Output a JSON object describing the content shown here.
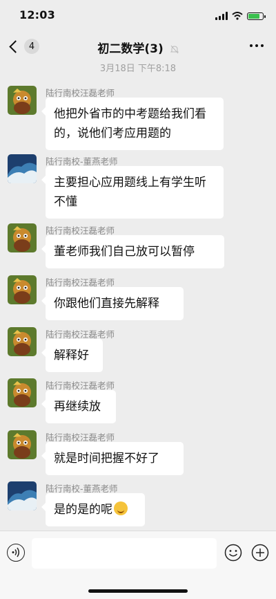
{
  "status_bar": {
    "time": "12:03"
  },
  "nav": {
    "unread_count": "4",
    "title": "初二数学(3)"
  },
  "timestamp": "3月18日 下午8:18",
  "messages": [
    {
      "sender": "陆行南校汪磊老师",
      "text": "他把外省市的中考题给我们看的，说他们考应用题的",
      "avatar": "cartoon-avatar"
    },
    {
      "sender": "陆行南校-董燕老师",
      "text": "主要担心应用题线上有学生听不懂",
      "avatar": "wave-avatar"
    },
    {
      "sender": "陆行南校汪磊老师",
      "text": "董老师我们自己放可以暂停",
      "avatar": "cartoon-avatar"
    },
    {
      "sender": "陆行南校汪磊老师",
      "text": "你跟他们直接先解释",
      "avatar": "cartoon-avatar"
    },
    {
      "sender": "陆行南校汪磊老师",
      "text": "解释好",
      "avatar": "cartoon-avatar"
    },
    {
      "sender": "陆行南校汪磊老师",
      "text": "再继续放",
      "avatar": "cartoon-avatar"
    },
    {
      "sender": "陆行南校汪磊老师",
      "text": "就是时间把握不好了",
      "avatar": "cartoon-avatar"
    },
    {
      "sender": "陆行南校-董燕老师",
      "text": "是的是的呢",
      "avatar": "wave-avatar",
      "emoji": "laughing-tears-emoji"
    }
  ],
  "status_icons": {
    "battery_charge": 0.85
  },
  "colors": {
    "background": "#ededed",
    "bubble": "#ffffff",
    "battery": "#3bc04e"
  }
}
